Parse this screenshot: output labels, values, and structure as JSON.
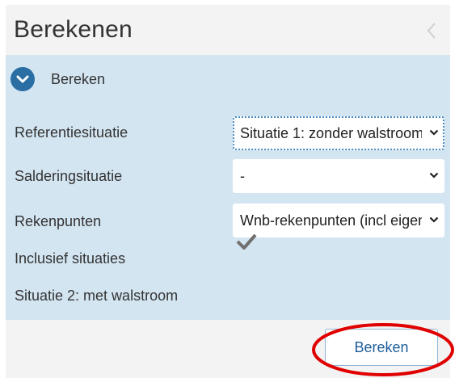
{
  "header": {
    "title": "Berekenen",
    "back_icon": "chevron-left-icon"
  },
  "section": {
    "label": "Bereken",
    "toggle_icon": "chevron-down-circle-icon",
    "accent": "#2a6ea4",
    "background": "#d3e5f1"
  },
  "fields": {
    "referentie": {
      "label": "Referentiesituatie",
      "value": "Situatie 1: zonder walstroom"
    },
    "saldering": {
      "label": "Salderingsituatie",
      "value": "-"
    },
    "rekenpunten": {
      "label": "Rekenpunten",
      "value": "Wnb-rekenpunten (incl eigen rekenpunten)"
    }
  },
  "included": {
    "heading": "Inclusief situaties",
    "items": [
      {
        "label": "Situatie 2: met walstroom",
        "checked": true,
        "icon": "checkmark-icon"
      }
    ]
  },
  "actions": {
    "calculate_label": "Bereken",
    "highlight_color": "#e00000"
  }
}
